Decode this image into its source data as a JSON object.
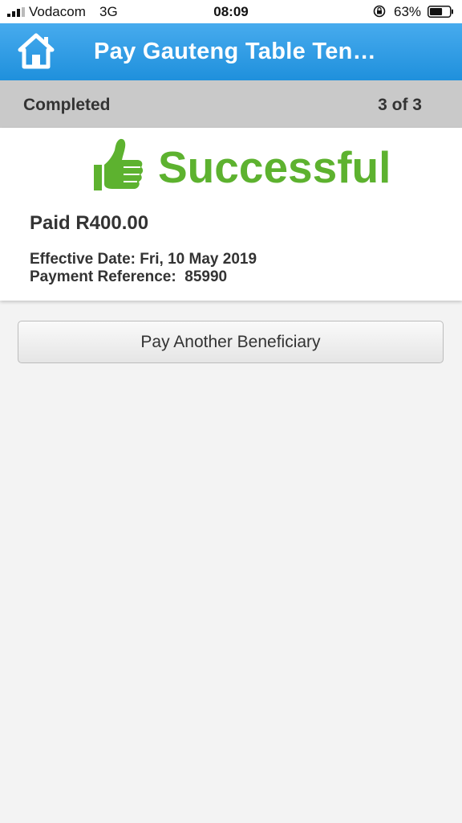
{
  "status_bar": {
    "carrier": "Vodacom",
    "network": "3G",
    "time": "08:09",
    "battery_percent": "63%",
    "signal_icon": "signal-bars-icon",
    "lock_icon": "orientation-lock-icon",
    "battery_icon": "battery-icon",
    "battery_level": 0.63
  },
  "header": {
    "title": "Pay Gauteng Table Ten…",
    "home_icon": "home-icon",
    "background_color": "#2b9be4"
  },
  "step_bar": {
    "label": "Completed",
    "step": "3 of 3"
  },
  "result": {
    "icon": "thumbs-up-icon",
    "status": "Successful",
    "status_color": "#5db22f",
    "paid": "Paid R400.00",
    "effective_date": "Effective Date: Fri, 10 May 2019",
    "payment_reference": "Payment Reference:  85990"
  },
  "actions": {
    "pay_another_label": "Pay Another Beneficiary"
  }
}
